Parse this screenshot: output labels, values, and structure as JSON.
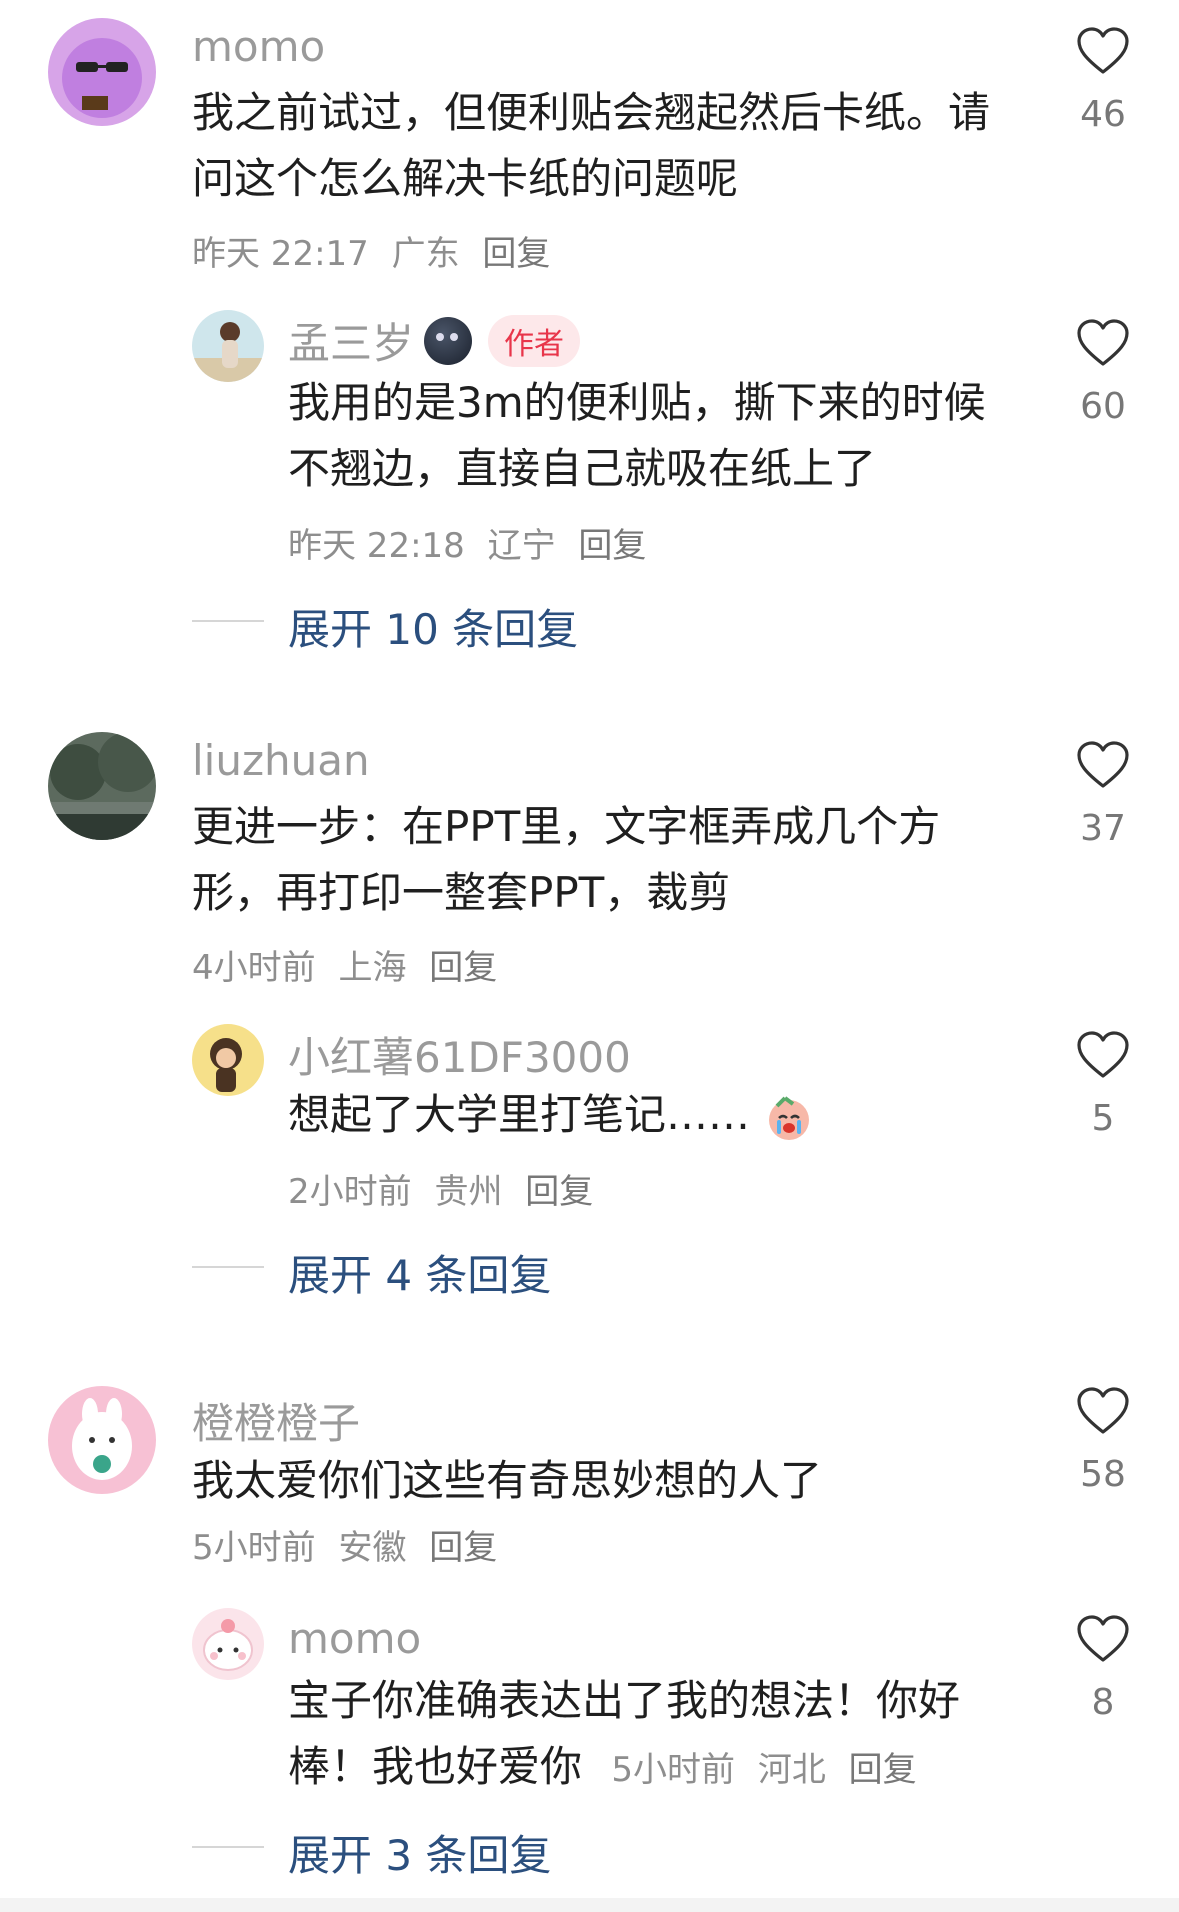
{
  "comments": [
    {
      "user": "momo",
      "text_line1": "我之前试过，但便利贴会翘起然后卡纸。请",
      "text_line2": "问这个怎么解决卡纸的问题呢",
      "time": "昨天 22:17",
      "location": "广东",
      "reply": "回复",
      "likes": "46",
      "replies": [
        {
          "user": "孟三岁",
          "badge": "作者",
          "text_line1": "我用的是3m的便利贴，撕下来的时候",
          "text_line2": "不翘边，直接自己就吸在纸上了",
          "time": "昨天 22:18",
          "location": "辽宁",
          "reply": "回复",
          "likes": "60"
        }
      ],
      "expand": "展开 10 条回复"
    },
    {
      "user": "liuzhuan",
      "text_line1": "更进一步：在PPT里，文字框弄成几个方",
      "text_line2": "形，再打印一整套PPT，裁剪",
      "time": "4小时前",
      "location": "上海",
      "reply": "回复",
      "likes": "37",
      "replies": [
        {
          "user": "小红薯61DF3000",
          "text_line1": "想起了大学里打笔记……",
          "time": "2小时前",
          "location": "贵州",
          "reply": "回复",
          "likes": "5"
        }
      ],
      "expand": "展开 4 条回复"
    },
    {
      "user": "橙橙橙子",
      "text_line1": "我太爱你们这些有奇思妙想的人了",
      "time": "5小时前",
      "location": "安徽",
      "reply": "回复",
      "likes": "58",
      "replies": [
        {
          "user": "momo",
          "text_line1": "宝子你准确表达出了我的想法！你好",
          "text_line2": "棒！我也好爱你",
          "time": "5小时前",
          "location": "河北",
          "reply": "回复",
          "likes": "8"
        }
      ],
      "expand": "展开 3 条回复"
    }
  ]
}
